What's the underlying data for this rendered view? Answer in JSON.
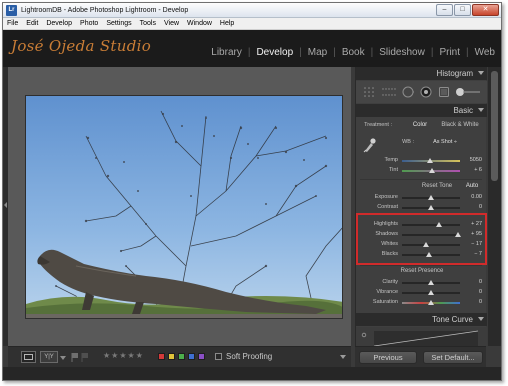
{
  "window": {
    "title": "LightroomDB - Adobe Photoshop Lightroom - Develop",
    "icon": "Lr"
  },
  "menu": [
    "File",
    "Edit",
    "Develop",
    "Photo",
    "Settings",
    "Tools",
    "View",
    "Window",
    "Help"
  ],
  "identity_plate": "José Ojeda Studio",
  "modules": {
    "items": [
      "Library",
      "Develop",
      "Map",
      "Book",
      "Slideshow",
      "Print",
      "Web"
    ],
    "active": "Develop"
  },
  "panels": {
    "histogram": {
      "title": "Histogram"
    },
    "basic": {
      "title": "Basic",
      "treatment_label": "Treatment :",
      "treatment_color": "Color",
      "treatment_bw": "Black & White",
      "wb_label": "WB :",
      "wb_value": "As Shot ÷",
      "wb_sliders": [
        {
          "label": "Temp",
          "value": "5050",
          "fraction": 0.48
        },
        {
          "label": "Tint",
          "value": "+ 6",
          "fraction": 0.52
        }
      ],
      "tone_label": "Reset Tone",
      "auto_label": "Auto",
      "tone_sliders": [
        {
          "label": "Exposure",
          "value": "0.00",
          "fraction": 0.5
        },
        {
          "label": "Contrast",
          "value": "0",
          "fraction": 0.5
        }
      ],
      "highlight_sliders": [
        {
          "label": "Highlights",
          "value": "+ 27",
          "fraction": 0.63
        },
        {
          "label": "Shadows",
          "value": "+ 95",
          "fraction": 0.97
        },
        {
          "label": "Whites",
          "value": "− 17",
          "fraction": 0.42
        },
        {
          "label": "Blacks",
          "value": "− 7",
          "fraction": 0.47
        }
      ],
      "presence_label": "Reset Presence",
      "presence_sliders": [
        {
          "label": "Clarity",
          "value": "0",
          "fraction": 0.5
        },
        {
          "label": "Vibrance",
          "value": "0",
          "fraction": 0.5
        },
        {
          "label": "Saturation",
          "value": "0",
          "fraction": 0.5
        }
      ]
    },
    "tone_curve": {
      "title": "Tone Curve"
    }
  },
  "buttons": {
    "previous": "Previous",
    "set_default": "Set Default..."
  },
  "toolbar": {
    "rating": 0,
    "stars": 5,
    "color_labels": [
      "#d43a3a",
      "#e0c33a",
      "#4cae4c",
      "#3f6fd1",
      "#8a4fc4"
    ],
    "soft_proofing": "Soft Proofing"
  }
}
